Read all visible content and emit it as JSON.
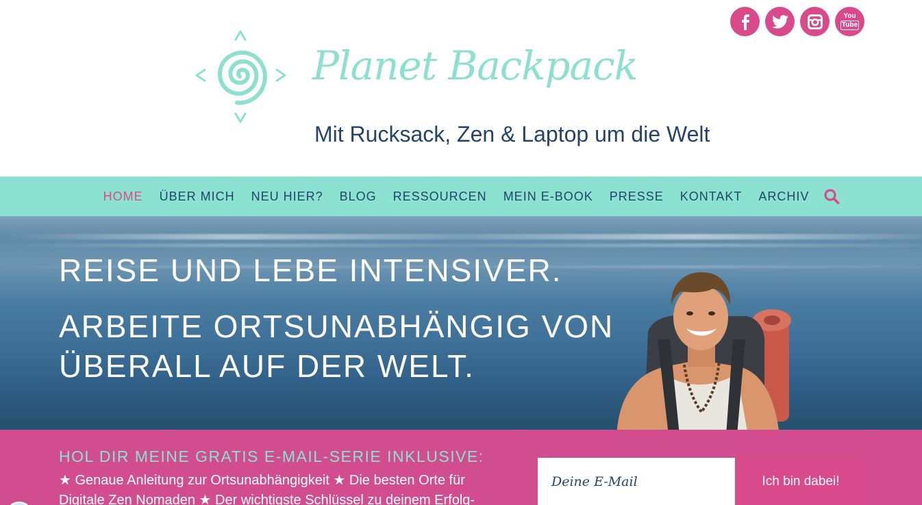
{
  "social": {
    "items": [
      {
        "name": "facebook",
        "icon": "facebook-icon"
      },
      {
        "name": "twitter",
        "icon": "twitter-icon"
      },
      {
        "name": "instagram",
        "icon": "instagram-icon"
      },
      {
        "name": "youtube",
        "icon": "youtube-icon",
        "text_top": "You",
        "text_bottom": "Tube"
      }
    ],
    "color": "#d94a8c"
  },
  "brand": {
    "title": "Planet Backpack",
    "tagline": "Mit Rucksack, Zen & Laptop um die Welt",
    "logo_icon": "spiral-compass-icon",
    "color": "#8de0cf"
  },
  "nav": {
    "items": [
      {
        "label": "HOME",
        "active": true
      },
      {
        "label": "ÜBER MICH",
        "active": false
      },
      {
        "label": "NEU HIER?",
        "active": false
      },
      {
        "label": "BLOG",
        "active": false
      },
      {
        "label": "RESSOURCEN",
        "active": false
      },
      {
        "label": "MEIN E-BOOK",
        "active": false
      },
      {
        "label": "PRESSE",
        "active": false
      },
      {
        "label": "KONTAKT",
        "active": false
      },
      {
        "label": "ARCHIV",
        "active": false
      }
    ],
    "search_icon": "search-icon",
    "background": "#8be2d0",
    "active_color": "#d94a8c"
  },
  "hero": {
    "headline": "REISE UND LEBE INTENSIVER.",
    "subheadline_line1": "ARBEITE ORTSUNABHÄNGIG VON",
    "subheadline_line2": "ÜBERALL AUF DER WELT."
  },
  "signup": {
    "heading": "HOL DIR MEINE GRATIS E-MAIL-SERIE INKLUSIVE:",
    "text": "★ Genaue Anleitung zur Ortsunabhängigkeit ★ Die besten Orte für Digitale Zen Nomaden ★ Der wichtigste Schlüssel zu deinem Erfolg-",
    "email_placeholder": "Deine E-Mail",
    "email_value": "",
    "button_label": "Ich bin dabei!"
  }
}
